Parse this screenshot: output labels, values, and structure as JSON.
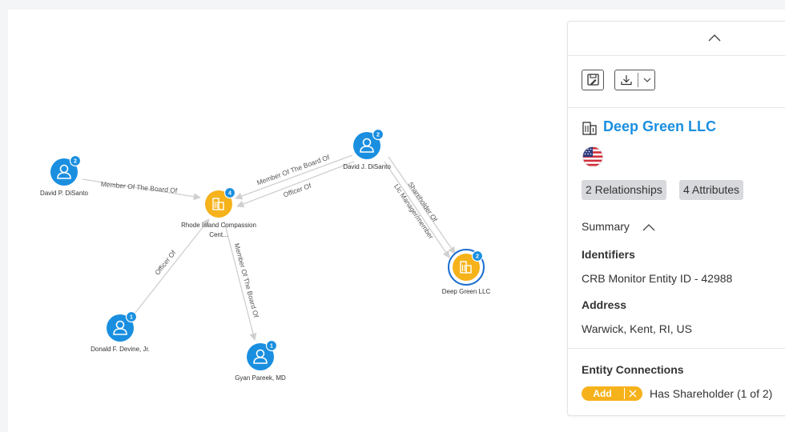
{
  "graph": {
    "nodes": [
      {
        "id": "david-p",
        "label_lines": [
          "David P. DiSanto"
        ],
        "kind": "person",
        "badge": "2"
      },
      {
        "id": "rhode",
        "label_lines": [
          "Rhode Island Compassion",
          "Cent..."
        ],
        "kind": "org",
        "badge": "4"
      },
      {
        "id": "david-j",
        "label_lines": [
          "David J. DiSanto"
        ],
        "kind": "person",
        "badge": "2"
      },
      {
        "id": "deep-green",
        "label_lines": [
          "Deep Green LLC"
        ],
        "kind": "org",
        "badge": "2",
        "selected": true
      },
      {
        "id": "donald",
        "label_lines": [
          "Donald F. Devine, Jr."
        ],
        "kind": "person",
        "badge": "1"
      },
      {
        "id": "gyan",
        "label_lines": [
          "Gyan Pareek, MD"
        ],
        "kind": "person",
        "badge": "1"
      }
    ],
    "edges": [
      {
        "from": "david-p",
        "to": "rhode",
        "label": "Member Of The Board Of"
      },
      {
        "from": "david-j",
        "to": "rhode",
        "label": "Member Of The Board Of"
      },
      {
        "from": "david-j",
        "to": "rhode",
        "label": "Officer Of"
      },
      {
        "from": "david-j",
        "to": "deep-green",
        "label": "Shareholder Of"
      },
      {
        "from": "david-j",
        "to": "deep-green",
        "label": "Llc Manager/member"
      },
      {
        "from": "donald",
        "to": "rhode",
        "label": "Officer Of"
      },
      {
        "from": "gyan",
        "to": "rhode",
        "label": "Member Of The Board Of"
      }
    ],
    "colors": {
      "person": "#1a8fe0",
      "org": "#f6b21b",
      "badge": "#1a8fe0",
      "edge": "#cfcfcf",
      "selected_ring": "#1a6fd0"
    }
  },
  "panel": {
    "entity_name": "Deep Green LLC",
    "relationships_chip": "2 Relationships",
    "attributes_chip": "4 Attributes",
    "summary_label": "Summary",
    "identifiers_heading": "Identifiers",
    "identifier_value": "CRB Monitor Entity ID - 42988",
    "address_heading": "Address",
    "address_value": "Warwick, Kent, RI, US",
    "connections_heading": "Entity Connections",
    "add_label": "Add",
    "connection_text": "Has Shareholder (1 of 2)",
    "accent_color": "#1a8fe0"
  }
}
